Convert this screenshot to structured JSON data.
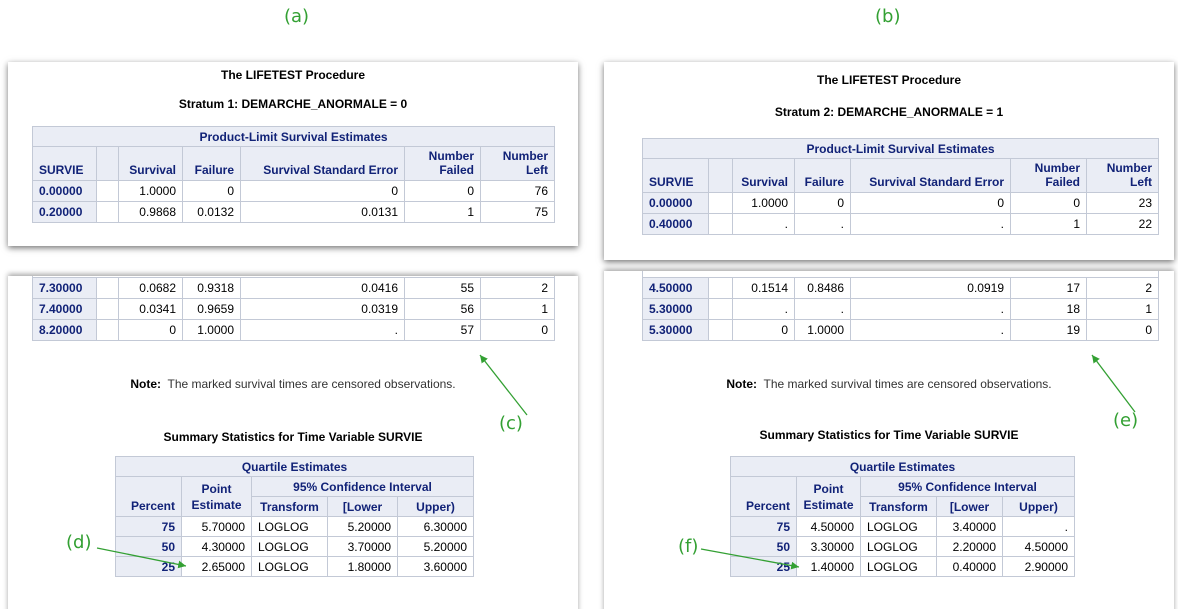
{
  "panel_labels": {
    "a": "(a)",
    "b": "(b)"
  },
  "callouts": {
    "c": "(c)",
    "d": "(d)",
    "e": "(e)",
    "f": "(f)"
  },
  "colors": {
    "annotation": "#33a033",
    "header_bg": "#eaedf5",
    "header_text": "#112277",
    "grid": "#c3c9d6"
  },
  "common": {
    "procedure_title": "The LIFETEST Procedure",
    "pl_title": "Product-Limit Survival Estimates",
    "col_survie": "SURVIE",
    "col_survival": "Survival",
    "col_failure": "Failure",
    "col_sse": "Survival Standard Error",
    "col_failed_1": "Number",
    "col_failed_2": "Failed",
    "col_left_1": "Number",
    "col_left_2": "Left",
    "note_bold": "Note:",
    "note_text": "The marked survival times are censored observations.",
    "summary_title": "Summary Statistics for Time Variable SURVIE",
    "q_title": "Quartile Estimates",
    "q_point_1": "Point",
    "q_point_2": "Estimate",
    "q_ci": "95% Confidence Interval",
    "q_percent": "Percent",
    "q_transform": "Transform",
    "q_lower": "[Lower",
    "q_upper": "Upper)"
  },
  "a": {
    "stratum": "Stratum 1: DEMARCHE_ANORMALE = 0",
    "top_rows": [
      {
        "t": "0.00000",
        "mark": "",
        "surv": "1.0000",
        "fail": "0",
        "sse": "0",
        "nf": "0",
        "nl": "76"
      },
      {
        "t": "0.20000",
        "mark": "",
        "surv": "0.9868",
        "fail": "0.0132",
        "sse": "0.0131",
        "nf": "1",
        "nl": "75"
      }
    ],
    "bottom_rows": [
      {
        "t": "7.30000",
        "mark": "",
        "surv": "0.0682",
        "fail": "0.9318",
        "sse": "0.0416",
        "nf": "55",
        "nl": "2"
      },
      {
        "t": "7.40000",
        "mark": "",
        "surv": "0.0341",
        "fail": "0.9659",
        "sse": "0.0319",
        "nf": "56",
        "nl": "1"
      },
      {
        "t": "8.20000",
        "mark": "",
        "surv": "0",
        "fail": "1.0000",
        "sse": ".",
        "nf": "57",
        "nl": "0"
      }
    ],
    "quartiles": [
      {
        "pct": "75",
        "est": "5.70000",
        "tr": "LOGLOG",
        "lo": "5.20000",
        "up": "6.30000"
      },
      {
        "pct": "50",
        "est": "4.30000",
        "tr": "LOGLOG",
        "lo": "3.70000",
        "up": "5.20000"
      },
      {
        "pct": "25",
        "est": "2.65000",
        "tr": "LOGLOG",
        "lo": "1.80000",
        "up": "3.60000"
      }
    ]
  },
  "b": {
    "stratum": "Stratum 2: DEMARCHE_ANORMALE = 1",
    "top_rows": [
      {
        "t": "0.00000",
        "mark": "",
        "surv": "1.0000",
        "fail": "0",
        "sse": "0",
        "nf": "0",
        "nl": "23"
      },
      {
        "t": "0.40000",
        "mark": "",
        "surv": ".",
        "fail": ".",
        "sse": ".",
        "nf": "1",
        "nl": "22"
      }
    ],
    "bottom_rows": [
      {
        "t": "4.50000",
        "mark": "",
        "surv": "0.1514",
        "fail": "0.8486",
        "sse": "0.0919",
        "nf": "17",
        "nl": "2"
      },
      {
        "t": "5.30000",
        "mark": "",
        "surv": ".",
        "fail": ".",
        "sse": ".",
        "nf": "18",
        "nl": "1"
      },
      {
        "t": "5.30000",
        "mark": "",
        "surv": "0",
        "fail": "1.0000",
        "sse": ".",
        "nf": "19",
        "nl": "0"
      }
    ],
    "quartiles": [
      {
        "pct": "75",
        "est": "4.50000",
        "tr": "LOGLOG",
        "lo": "3.40000",
        "up": "."
      },
      {
        "pct": "50",
        "est": "3.30000",
        "tr": "LOGLOG",
        "lo": "2.20000",
        "up": "4.50000"
      },
      {
        "pct": "25",
        "est": "1.40000",
        "tr": "LOGLOG",
        "lo": "0.40000",
        "up": "2.90000"
      }
    ]
  }
}
